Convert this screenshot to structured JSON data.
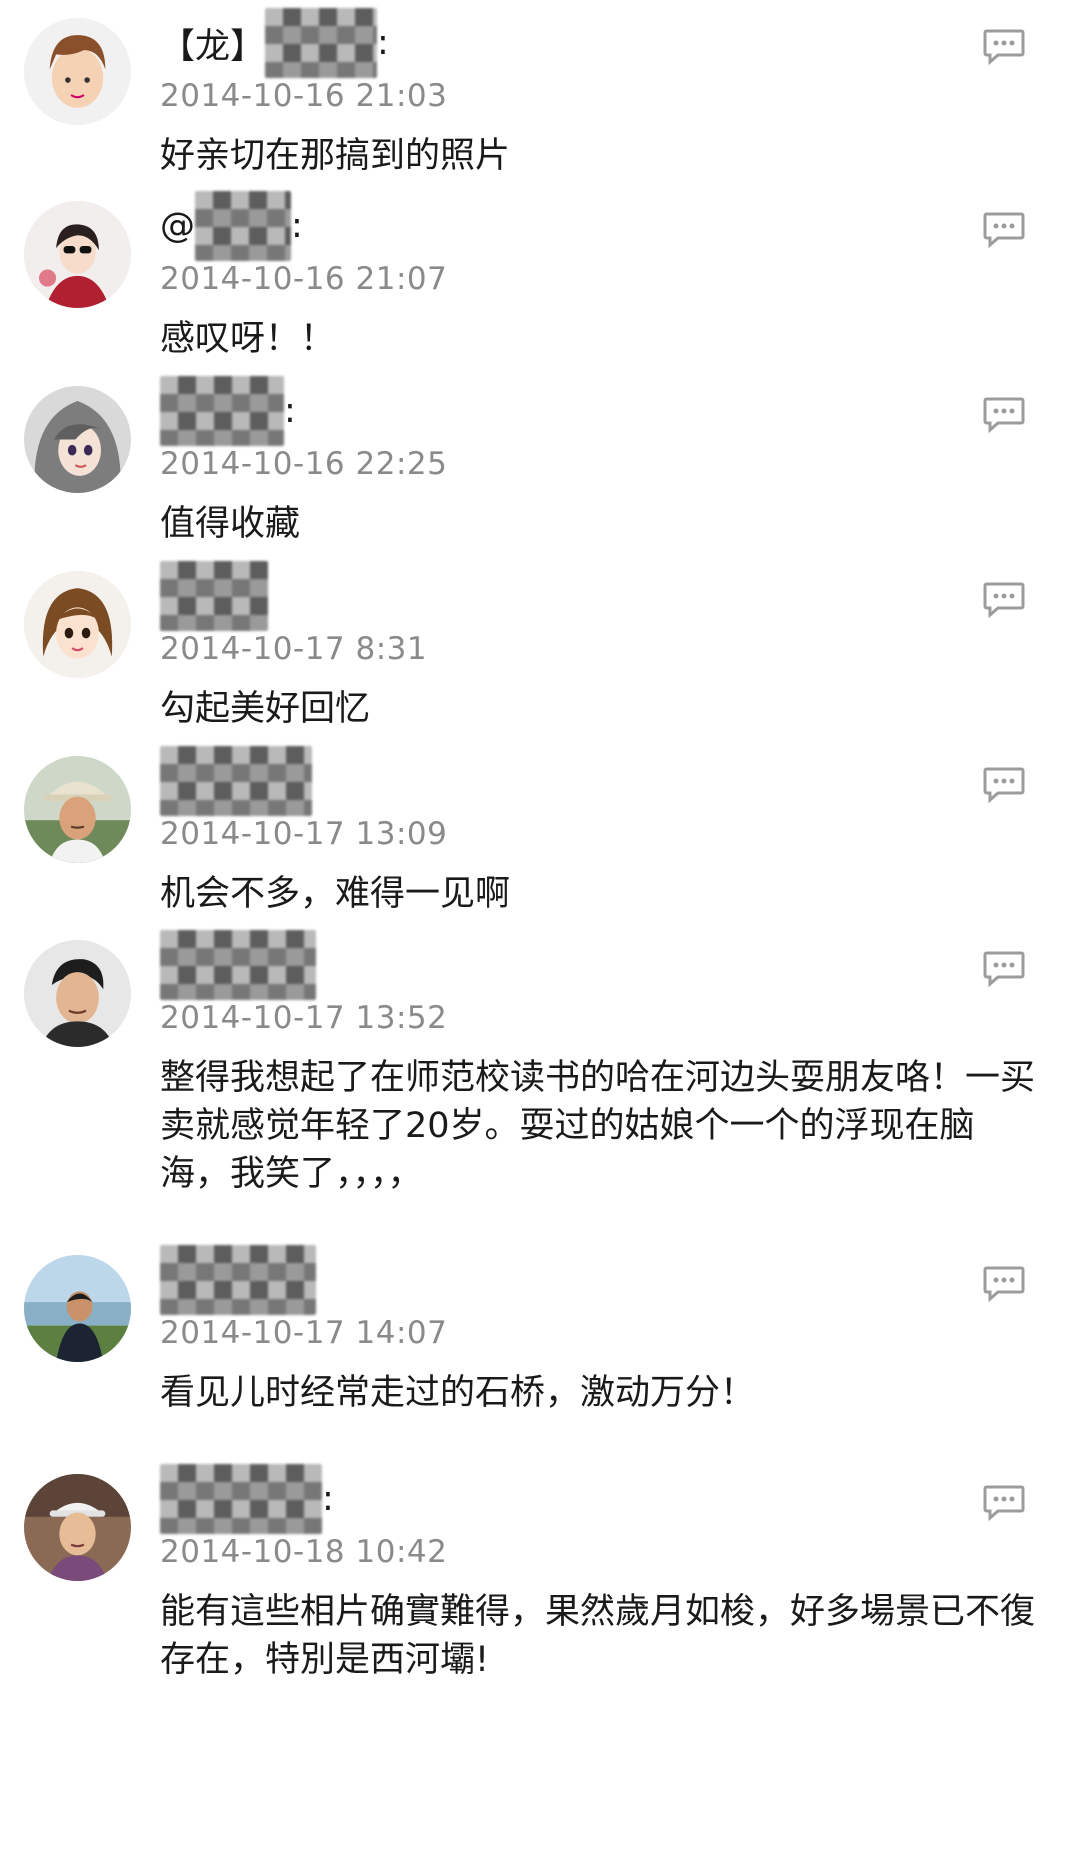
{
  "comments": [
    {
      "name_prefix": "【龙】",
      "name_suffix": ":",
      "time": "2014-10-16 21:03",
      "text": "好亲切在那搞到的照片",
      "avatar": "boy-cartoon-avatar"
    },
    {
      "name_prefix": "@",
      "name_suffix": ":",
      "time": "2014-10-16 21:07",
      "text": "感叹呀！！",
      "avatar": "woman-sunglasses-avatar"
    },
    {
      "name_prefix": "",
      "name_suffix": ":",
      "time": "2014-10-16 22:25",
      "text": "值得收藏",
      "avatar": "anime-gray-hair-avatar"
    },
    {
      "name_prefix": "",
      "name_suffix": "",
      "time": "2014-10-17 8:31",
      "text": "勾起美好回忆",
      "avatar": "cartoon-girl-avatar"
    },
    {
      "name_prefix": "",
      "name_suffix": "",
      "time": "2014-10-17 13:09",
      "text": "机会不多，难得一见啊",
      "avatar": "man-hat-avatar"
    },
    {
      "name_prefix": "",
      "name_suffix": "",
      "time": "2014-10-17 13:52",
      "text": "整得我想起了在师范校读书的哈在河边头耍朋友咯！一买卖就感觉年轻了20岁。耍过的姑娘个一个的浮现在脑海，我笑了，，，，",
      "avatar": "man-portrait-avatar"
    },
    {
      "name_prefix": "",
      "name_suffix": "",
      "time": "2014-10-17 14:07",
      "text": "看见儿时经常走过的石桥，激动万分！",
      "avatar": "woman-lake-avatar"
    },
    {
      "name_prefix": "",
      "name_suffix": ":",
      "time": "2014-10-18 10:42",
      "text": "能有這些相片确實難得，果然歲月如梭，好多場景已不復存在，特別是西河壩!",
      "avatar": "woman-cap-avatar"
    }
  ],
  "icons": {
    "reply": "comment-reply-icon"
  },
  "colors": {
    "timestamp": "#8a8a8a",
    "icon": "#9c9c9c"
  }
}
